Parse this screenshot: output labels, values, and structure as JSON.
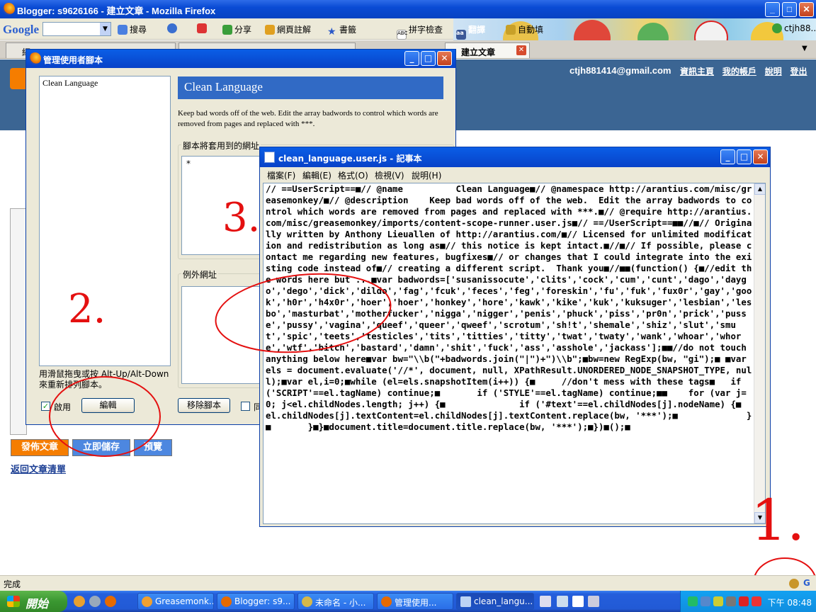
{
  "browser": {
    "title": "Blogger: s9626166 - 建立文章 - Mozilla Firefox",
    "toolbar": {
      "logo": "Google",
      "search_label": "搜尋",
      "share_label": "分享",
      "bookmark_page_label": "網頁註解",
      "bookmarks_label": "書籤",
      "spellcheck_label": "拼字檢查",
      "translate_label": "翻譯",
      "autofill_label": "自動填",
      "account_label": "ctjh88..."
    },
    "tabs": [
      {
        "label": "網..."
      },
      {
        "label": "..."
      },
      {
        "label": "建立文章"
      }
    ],
    "status": "完成"
  },
  "blogger": {
    "email": "ctjh881414@gmail.com",
    "links": [
      "資訊主頁",
      "我的帳戶",
      "說明",
      "登出"
    ],
    "publish_label": "發佈文章",
    "save_label": "立即儲存",
    "preview_label": "預覽",
    "back_link": "返回文章清單"
  },
  "gm_dialog": {
    "title": "管理使用者腳本",
    "scripts": [
      "Clean Language"
    ],
    "script_name": "Clean Language",
    "description": "Keep bad words off of the web. Edit the array badwords to control which words are removed from pages and replaced with ***.",
    "include_label": "腳本將套用到的網址",
    "include_value": "*",
    "exclude_label": "例外網址",
    "hint": "用滑鼠拖曳或按 Alt-Up/Alt-Down 來重新排列腳本。",
    "enabled_label": "啟用",
    "enabled": true,
    "edit_label": "編輯",
    "uninstall_label": "移除腳本",
    "also_label": "同"
  },
  "notepad": {
    "title": "clean_language.user.js - 記事本",
    "menu": [
      "檔案(F)",
      "編輯(E)",
      "格式(O)",
      "檢視(V)",
      "說明(H)"
    ],
    "content": "// ==UserScript==■// @name          Clean Language■// @namespace http://arantius.com/misc/greasemonkey/■// @description    Keep bad words off of the web.  Edit the array badwords to control which words are removed from pages and replaced with ***.■// @require http://arantius.com/misc/greasemonkey/imports/content-scope-runner.user.js■// ==/UserScript==■■//■// Originally written by Anthony Lieuallen of http://arantius.com/■// Licensed for unlimited modification and redistribution as long as■// this notice is kept intact.■//■// If possible, please contact me regarding new features, bugfixes■// or changes that I could integrate into the existing code instead of■// creating a different script.  Thank you■//■■(function() {■//edit the words here but ...■var badwords=['susanissocute','clits','cock','cum','cunt','dago','daygo','dego','dick','dildo','fag','fcuk','feces','feg','foreskin','fu','fuk','fux0r','gay','gook','h0r','h4x0r','hoer','hoer','honkey','hore','kawk','kike','kuk','kuksuger','lesbian','lesbo','masturbat','motherfucker','nigga','nigger','penis','phuck','piss','pr0n','prick','pusse','pussy','vagina','queef','queer','qweef','scrotum','sh!t','shemale','shiz','slut','smut','spic','teets','testicles','tits','titties','titty','twat','twaty','wank','whoar','whore','wtf','bitch','bastard','damn','shit','fuck','ass','asshole','jackass'];■■//do not touch anything below here■var bw=\"\\\\b(\"+badwords.join(\"|\")+\")\\\\b\";■bw=new RegExp(bw, \"gi\");■ ■var els = document.evaluate('//*', document, null, XPathResult.UNORDERED_NODE_SNAPSHOT_TYPE, null);■var el,i=0;■while (el=els.snapshotItem(i++)) {■     //don't mess with these tags■   if ('SCRIPT'==el.tagName) continue;■       if ('STYLE'==el.tagName) continue;■■    for (var j=0; j<el.childNodes.length; j++) {■              if ('#text'==el.childNodes[j].nodeName) {■              el.childNodes[j].textContent=el.childNodes[j].textContent.replace(bw, '***');■             }■       }■}■document.title=document.title.replace(bw, '***');■})■();■"
  },
  "annotations": [
    "1.",
    "2.",
    "3."
  ],
  "taskbar": {
    "start_label": "開始",
    "tasks": [
      "Greasemonk...",
      "Blogger: s9...",
      "未命名 - 小...",
      "管理使用...",
      "clean_langu..."
    ],
    "clock": "下午 08:48"
  },
  "colors": {
    "annotation": "#e41010",
    "xp_blue": "#0a5ee6",
    "blogger_publish": "#f57d00",
    "blogger_save": "#4d87e0"
  }
}
